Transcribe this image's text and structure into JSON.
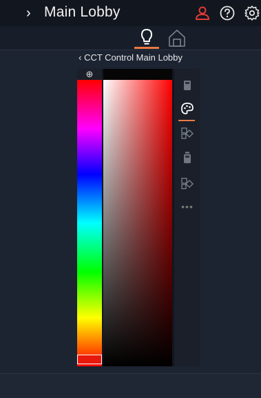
{
  "header": {
    "title": "Main Lobby",
    "expand_icon": "chevron-right-icon",
    "user_icon": "user-icon",
    "help_icon": "help-icon",
    "settings_icon": "gear-icon",
    "user_icon_color": "#e53935"
  },
  "tabs": [
    {
      "icon": "lightbulb-icon",
      "selected": true
    },
    {
      "icon": "home-icon",
      "selected": false
    }
  ],
  "breadcrumb": {
    "back_icon": "chevron-left-icon",
    "label": "CCT Control Main Lobby"
  },
  "color_picker": {
    "zoom_icon": "zoom-in-icon",
    "selected_hue_color": "#e8180d",
    "gradient_end_color": "#ff0000"
  },
  "side_toolbar": {
    "items": [
      {
        "icon": "device-icon",
        "selected": false
      },
      {
        "icon": "palette-icon",
        "selected": true
      },
      {
        "icon": "scene-icon",
        "selected": false
      },
      {
        "icon": "device-group-icon",
        "selected": false
      },
      {
        "icon": "scene-group-icon",
        "selected": false
      },
      {
        "icon": "more-icon",
        "selected": false
      }
    ]
  },
  "accent_color": "#ec7a44"
}
